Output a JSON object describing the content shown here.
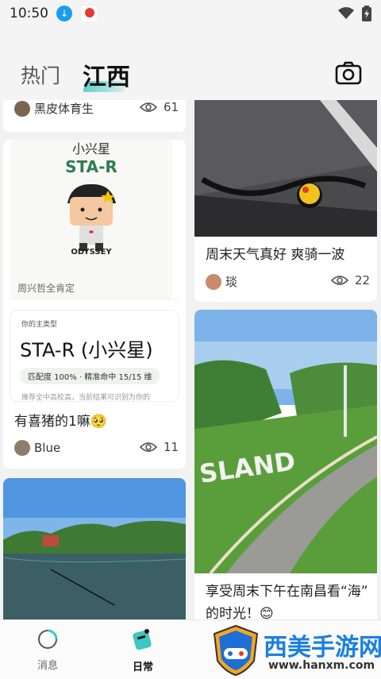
{
  "status": {
    "time": "10:50"
  },
  "header": {
    "tabs": [
      {
        "label": "热门"
      },
      {
        "label": "江西"
      }
    ]
  },
  "cards": {
    "top_left": {
      "author": "黑皮体育生",
      "views": "61"
    },
    "personality": {
      "small_title": "小兴星",
      "code": "STA-R",
      "brand": "ODYSSEY",
      "caption": "周兴哲全肯定"
    },
    "type_card": {
      "label": "你的主类型",
      "type": "STA-R (小兴星)",
      "match": "匹配度 100% · 精准命中 15/15 维",
      "desc": "推荐全中高校高，当前结果可识别为你的"
    },
    "pig": {
      "title": "有喜猪的1嘛🥺",
      "author": "Blue",
      "views": "11"
    },
    "bike": {
      "title": "周末天气真好 爽骑一波",
      "author": "琰",
      "views": "22"
    },
    "park": {
      "title_line1": "享受周末下午在南昌看“海”",
      "title_line2": "的时光！😊",
      "sign": "SLAND"
    }
  },
  "navbar": {
    "items": [
      {
        "label": "消息"
      },
      {
        "label": "日常"
      }
    ]
  },
  "watermark": {
    "title": "西美手游网",
    "url": "www.hanxm.com"
  }
}
